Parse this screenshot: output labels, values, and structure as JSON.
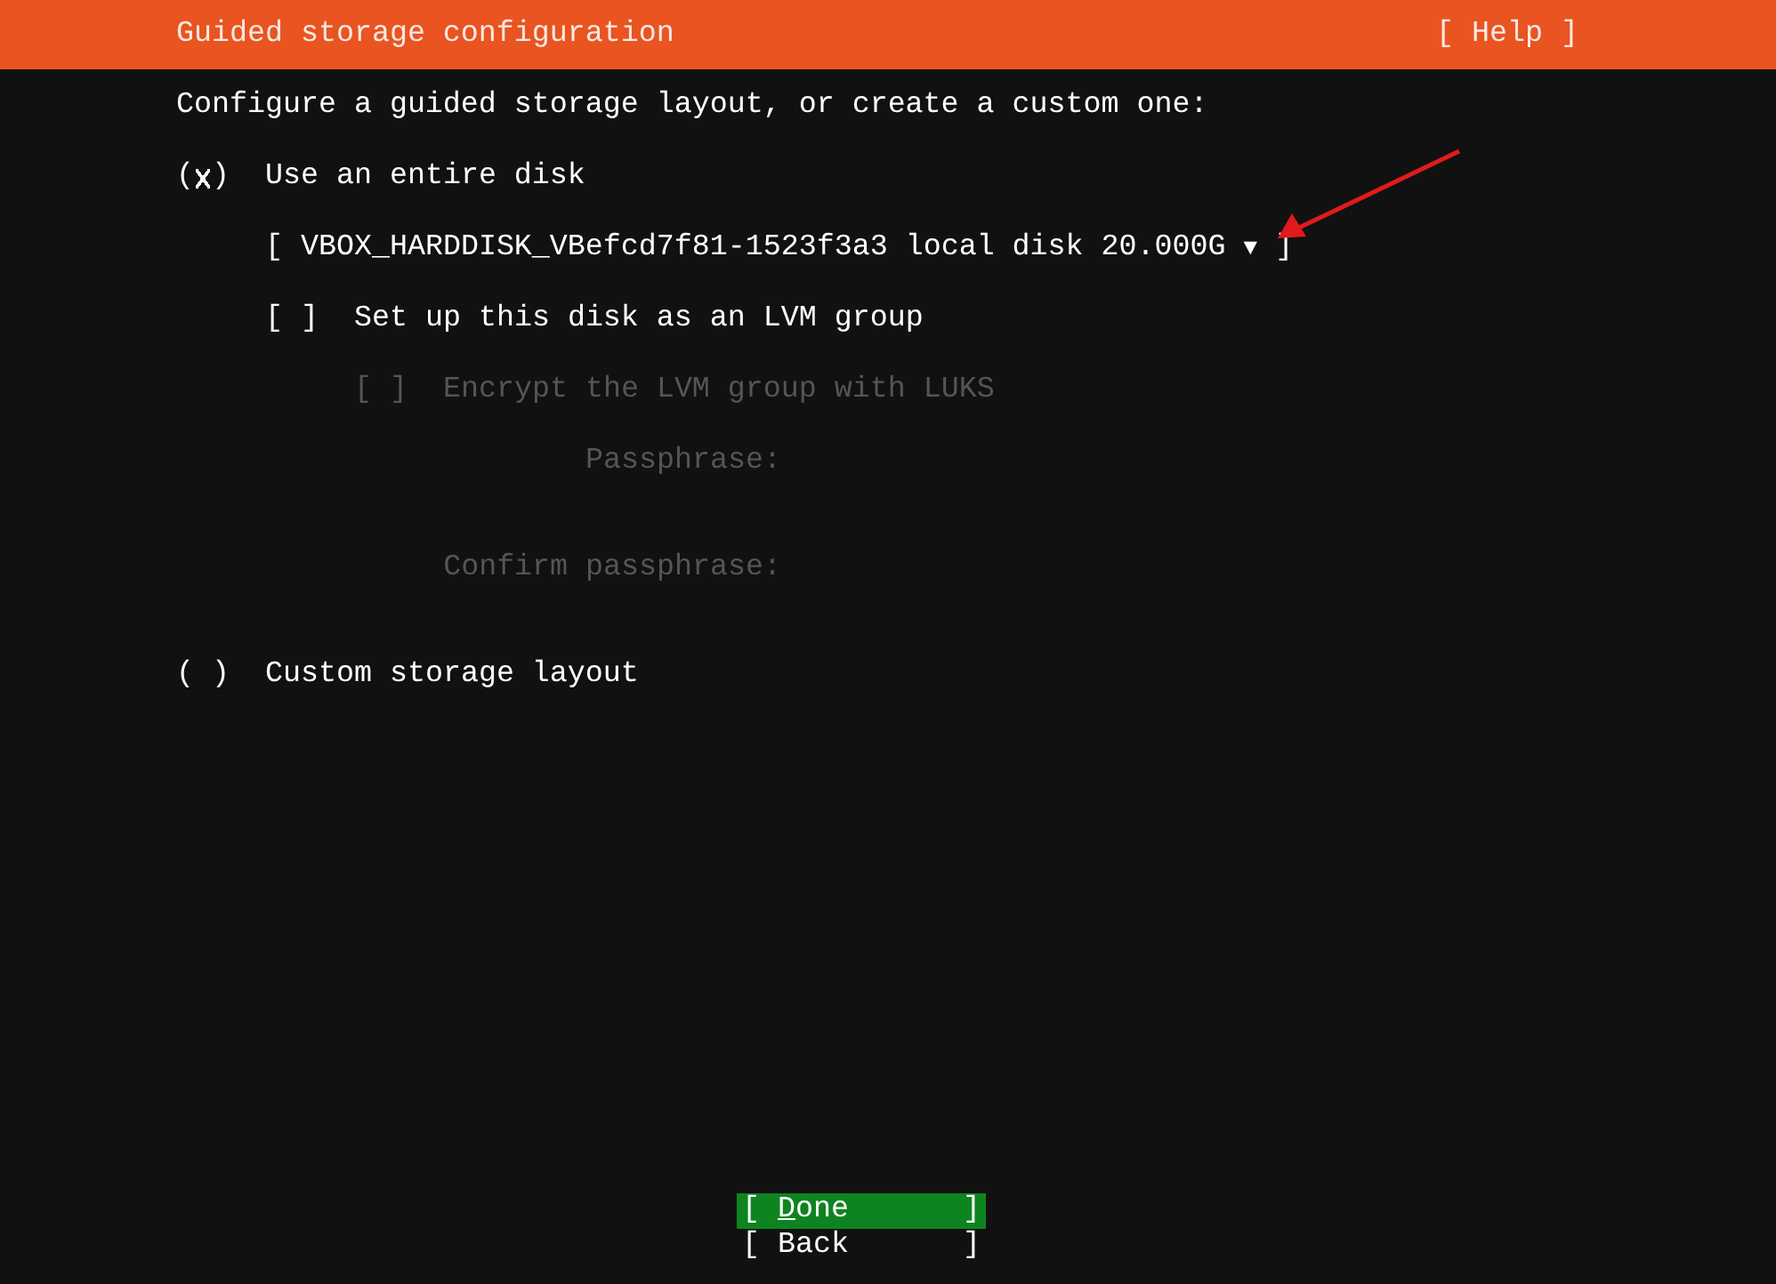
{
  "header": {
    "title": "Guided storage configuration",
    "help": "[ Help ]"
  },
  "intro": "Configure a guided storage layout, or create a custom one:",
  "options": [
    {
      "kind": "radio",
      "open": "(",
      "close": ")",
      "selected": true,
      "label": "Use an entire disk",
      "disabled": false
    },
    {
      "kind": "dropdown",
      "bracket_left": "[",
      "value": "VBOX_HARDDISK_VBefcd7f81-1523f3a3 local disk 20.000G",
      "caret": "▼",
      "bracket_right": "]",
      "disabled": false
    },
    {
      "kind": "checkbox",
      "open": "[",
      "close": "]",
      "checked": false,
      "label": "Set up this disk as an LVM group",
      "disabled": false
    },
    {
      "kind": "checkbox",
      "open": "[",
      "close": "]",
      "checked": false,
      "label": "Encrypt the LVM group with LUKS",
      "disabled": true
    },
    {
      "kind": "field",
      "label": "Passphrase:",
      "disabled": true
    },
    {
      "kind": "field",
      "label": "Confirm passphrase:",
      "disabled": true
    },
    {
      "kind": "radio",
      "open": "(",
      "close": ")",
      "selected": false,
      "label": "Custom storage layout",
      "disabled": false
    }
  ],
  "buttons": [
    {
      "bracket_left": "[",
      "label": "Done",
      "bracket_right": "]",
      "selected": true
    },
    {
      "bracket_left": "[",
      "label": "Back",
      "bracket_right": "]",
      "selected": false
    }
  ]
}
